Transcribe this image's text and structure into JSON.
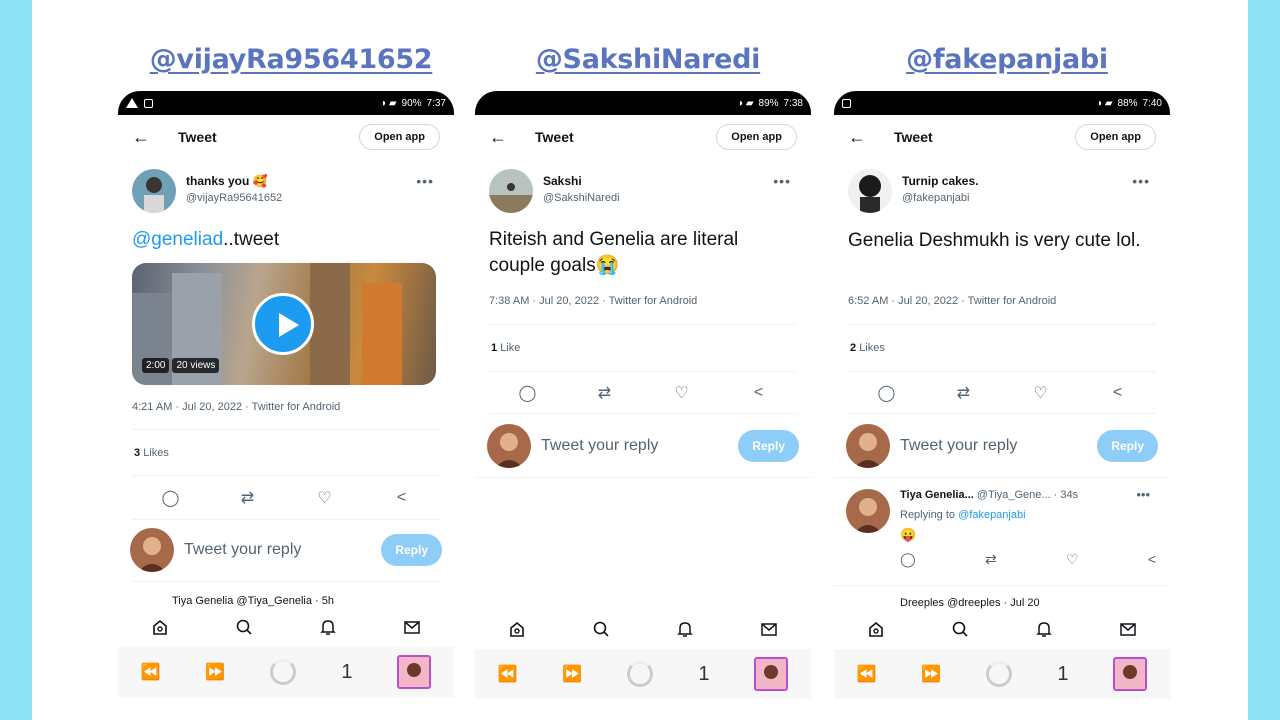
{
  "phones": [
    {
      "title": "@vijayRa95641652",
      "status": {
        "battery": "90%",
        "time": "7:37"
      },
      "header": {
        "title": "Tweet",
        "open_app": "Open app"
      },
      "author": {
        "name": "thanks you 🥰",
        "handle": "@vijayRa95641652"
      },
      "tweet": {
        "mention": "@geneliad",
        "text": "..tweet"
      },
      "video": {
        "duration": "2:00",
        "views": "20 views"
      },
      "timestamp": "4:21 AM · Jul 20, 2022 · Twitter for Android",
      "likes": {
        "count": "3",
        "label": "Likes"
      },
      "reply": {
        "placeholder": "Tweet your reply",
        "button": "Reply"
      },
      "peek": "Tiya Genelia @Tiya_Genelia · 5h"
    },
    {
      "title": "@SakshiNaredi",
      "status": {
        "battery": "89%",
        "time": "7:38"
      },
      "header": {
        "title": "Tweet",
        "open_app": "Open app"
      },
      "author": {
        "name": "Sakshi",
        "handle": "@SakshiNaredi"
      },
      "tweet": {
        "text": "Riteish and Genelia are literal couple goals😭"
      },
      "timestamp": "7:38 AM · Jul 20, 2022 · Twitter for Android",
      "likes": {
        "count": "1",
        "label": "Like"
      },
      "reply": {
        "placeholder": "Tweet your reply",
        "button": "Reply"
      }
    },
    {
      "title": "@fakepanjabi",
      "status": {
        "battery": "88%",
        "time": "7:40"
      },
      "header": {
        "title": "Tweet",
        "open_app": "Open app"
      },
      "author": {
        "name": "Turnip cakes.",
        "handle": "@fakepanjabi"
      },
      "tweet": {
        "text": "Genelia Deshmukh is very cute lol."
      },
      "timestamp": "6:52 AM · Jul 20, 2022 · Twitter for Android",
      "likes": {
        "count": "2",
        "label": "Likes"
      },
      "reply": {
        "placeholder": "Tweet your reply",
        "button": "Reply"
      },
      "comment": {
        "name": "Tiya Genelia...",
        "meta": "@Tiya_Gene... · 34s",
        "replying_label": "Replying to",
        "replying_to": "@fakepanjabi",
        "emoji": "😛"
      },
      "peek": "Dreeples @dreeples · Jul 20"
    }
  ],
  "browser": {
    "tab_count": "1"
  },
  "colors": {
    "background": "#8fe1f4",
    "title": "#5b74bf",
    "accent": "#1d9bf0",
    "reply_button": "#8ecdf8"
  }
}
